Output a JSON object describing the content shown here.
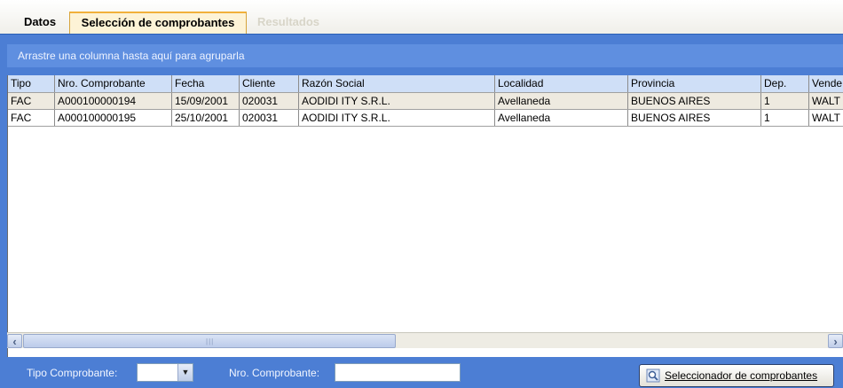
{
  "tabs": [
    {
      "label": "Datos"
    },
    {
      "label": "Selección de comprobantes"
    },
    {
      "label": "Resultados"
    }
  ],
  "group_hint": "Arrastre una columna hasta aquí para agruparla",
  "grid": {
    "columns": [
      "Tipo",
      "Nro. Comprobante",
      "Fecha",
      "Cliente",
      "Razón Social",
      "Localidad",
      "Provincia",
      "Dep.",
      "Vende"
    ],
    "rows": [
      [
        "FAC",
        "A000100000194",
        "15/09/2001",
        "020031",
        "AODIDI  ITY S.R.L.",
        "Avellaneda",
        "BUENOS AIRES",
        "1",
        "WALT"
      ],
      [
        "FAC",
        "A000100000195",
        "25/10/2001",
        "020031",
        "AODIDI  ITY S.R.L.",
        "Avellaneda",
        "BUENOS AIRES",
        "1",
        "WALT"
      ]
    ]
  },
  "filters": {
    "tipo_label": "Tipo Comprobante:",
    "tipo_value": "",
    "nro_label": "Nro. Comprobante:",
    "nro_value": ""
  },
  "buttons": {
    "seleccionador_label": "Seleccionador de comprobantes",
    "seleccionador_icon": "search-icon"
  },
  "colors": {
    "frame": "#4c7ed4",
    "active_tab_accent": "#f1b13a",
    "header": "#cfdff7",
    "selected_row": "#eeeae0"
  }
}
